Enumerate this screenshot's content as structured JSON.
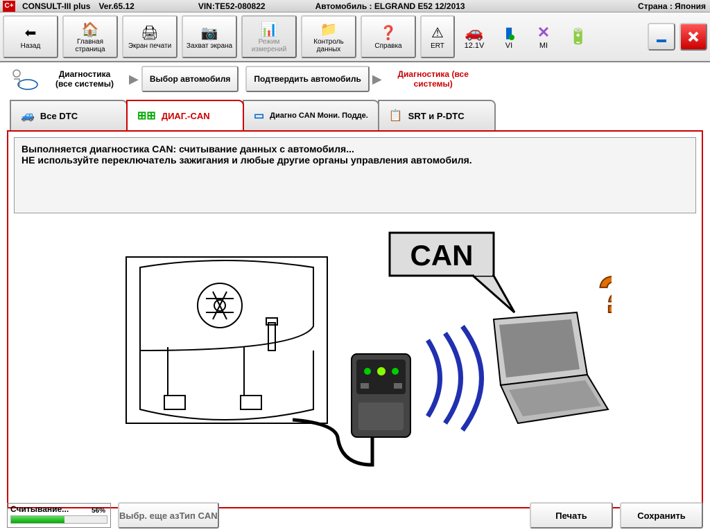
{
  "title": {
    "app": "CONSULT-III plus",
    "version": "Ver.65.12",
    "vin_label": "VIN:TE52-080822",
    "vehicle": "Автомобиль : ELGRAND E52 12/2013",
    "country": "Страна : Япония"
  },
  "toolbar": {
    "back": "Назад",
    "home": "Главная страница",
    "print_screen": "Экран печати",
    "capture": "Захват экрана",
    "measure": "Режим измерений",
    "data": "Контроль данных",
    "help": "Справка",
    "ert": "ERT",
    "voltage": "12.1V",
    "vi": "VI",
    "mi": "MI"
  },
  "breadcrumb": {
    "step1": "Диагностика (все системы)",
    "step2": "Выбор автомобиля",
    "step3": "Подтвердить автомобиль",
    "step4": "Диагностика (все системы)"
  },
  "tabs": {
    "all_dtc": "Все DTC",
    "diag_can": "ДИАГ.-CAN",
    "diagno_can": "Диагно CAN Мони. Подде.",
    "srt": "SRT и P-DTC"
  },
  "message": {
    "line1": "Выполняется диагностика CAN: считывание данных с автомобиля...",
    "line2": "НЕ используйте переключатель зажигания и любые другие органы управления автомобиля."
  },
  "diagram": {
    "can_label": "CAN",
    "question": "?"
  },
  "footer": {
    "reading": "Считывание...",
    "percent": "56%",
    "percent_val": 56,
    "select_type": "Выбр. еще азТип CAN",
    "print": "Печать",
    "save": "Сохранить"
  }
}
